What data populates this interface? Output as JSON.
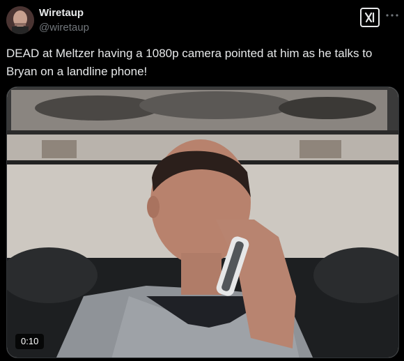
{
  "author": {
    "display_name": "Wiretaup",
    "handle": "@wiretaup",
    "avatar_icon": "profile-avatar"
  },
  "header_icons": {
    "grok_icon": "x-ai-logo-icon",
    "more_icon": "more-options-icon"
  },
  "tweet": {
    "text": "DEAD at Meltzer having a 1080p camera pointed at him as he talks to Bryan on a landline phone!"
  },
  "media": {
    "type": "video",
    "duration": "0:10"
  },
  "colors": {
    "background": "#000000",
    "text_primary": "#e7e9ea",
    "text_secondary": "#71767b"
  }
}
